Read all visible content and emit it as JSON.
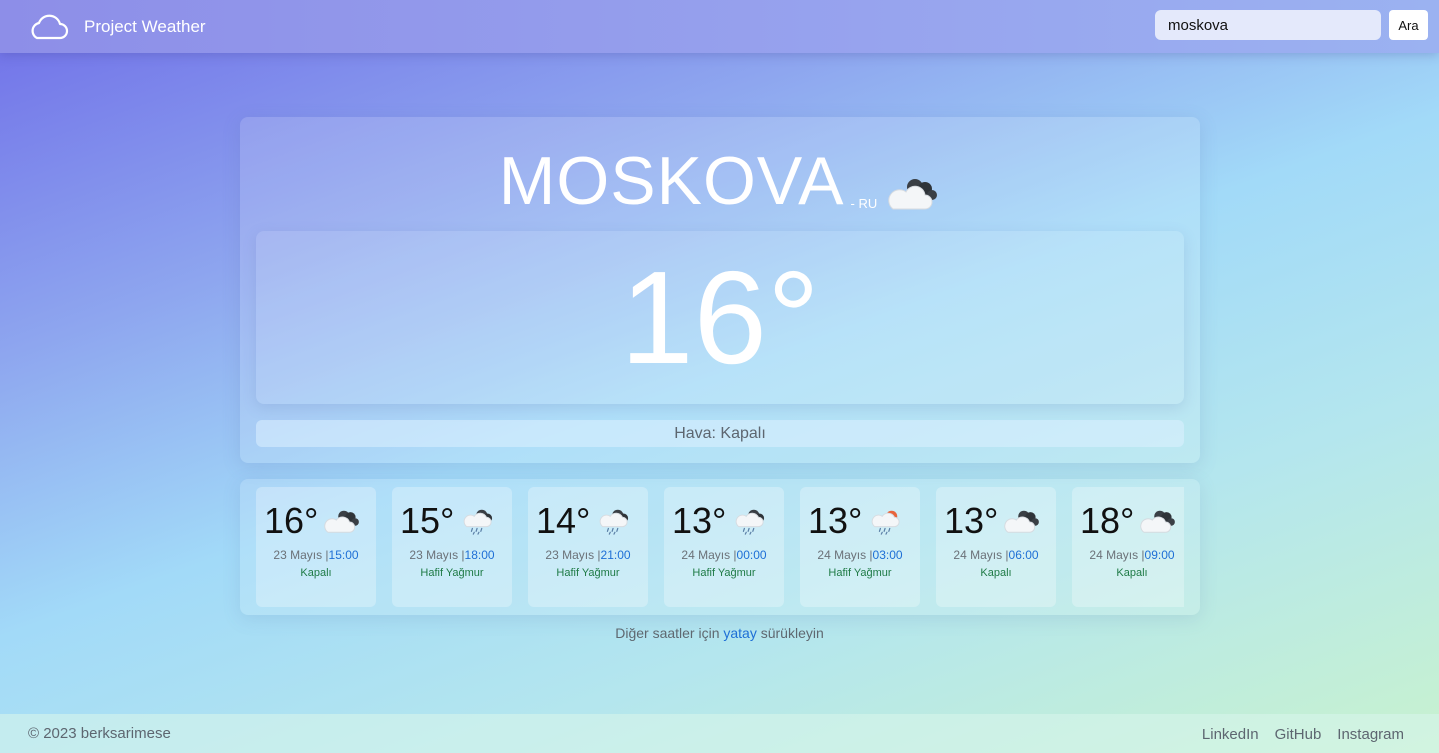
{
  "navbar": {
    "brand": "Project Weather",
    "brand_icon": "cloud-outline-icon",
    "search_value": "moskova",
    "search_button": "Ara"
  },
  "current": {
    "city": "MOSKOVA",
    "country": "- RU",
    "icon": "overcast-clouds-icon",
    "temperature": "16°",
    "description": "Hava: Kapalı"
  },
  "forecast": [
    {
      "temp": "16°",
      "date": "23 Mayıs",
      "time": "15:00",
      "condition": "Kapalı",
      "icon": "overcast-clouds-icon"
    },
    {
      "temp": "15°",
      "date": "23 Mayıs",
      "time": "18:00",
      "condition": "Hafif Yağmur",
      "icon": "light-rain-icon"
    },
    {
      "temp": "14°",
      "date": "23 Mayıs",
      "time": "21:00",
      "condition": "Hafif Yağmur",
      "icon": "light-rain-icon"
    },
    {
      "temp": "13°",
      "date": "24 Mayıs",
      "time": "00:00",
      "condition": "Hafif Yağmur",
      "icon": "light-rain-icon"
    },
    {
      "temp": "13°",
      "date": "24 Mayıs",
      "time": "03:00",
      "condition": "Hafif Yağmur",
      "icon": "light-rain-sun-icon"
    },
    {
      "temp": "13°",
      "date": "24 Mayıs",
      "time": "06:00",
      "condition": "Kapalı",
      "icon": "overcast-clouds-icon"
    },
    {
      "temp": "18°",
      "date": "24 Mayıs",
      "time": "09:00",
      "condition": "Kapalı",
      "icon": "overcast-clouds-icon"
    }
  ],
  "hint": {
    "before": "Diğer saatler için ",
    "highlight": "yatay",
    "after": " sürükleyin"
  },
  "footer": {
    "copyright": "© 2023 berksarimese",
    "links": [
      "LinkedIn",
      "GitHub",
      "Instagram"
    ]
  },
  "colors": {
    "link_blue": "#1e6fd6",
    "condition_green": "#1e7a45",
    "navbar": "#9099ec"
  }
}
